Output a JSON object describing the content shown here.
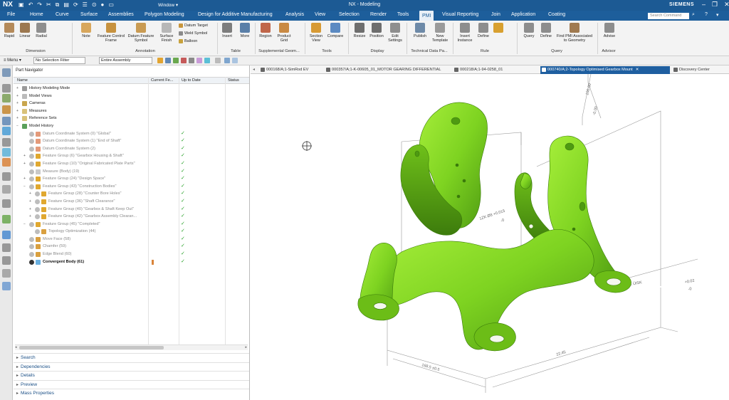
{
  "titlebar": {
    "logo": "NX",
    "window_menu": "Window ▾",
    "title": "NX - Modeling",
    "brand": "SIEMENS"
  },
  "menubar": {
    "items": [
      "File",
      "Home",
      "Curve",
      "Surface",
      "Assemblies",
      "Polygon Modeling",
      "Design for Additive Manufacturing",
      "Analysis",
      "View",
      "Selection",
      "Render",
      "Tools",
      "PMI",
      "Visual Reporting",
      "Join",
      "Application",
      "Coating"
    ],
    "active": "PMI",
    "search_placeholder": "Search Command"
  },
  "ribbon": {
    "dimension": {
      "buttons": [
        "Rapid",
        "Linear",
        "Radial"
      ],
      "label": "Dimension"
    },
    "annotation": {
      "buttons": [
        "Note",
        "Feature Control Frame",
        "Datum Feature Symbol",
        "Surface Finish"
      ],
      "small": [
        "Datum Target",
        "Weld Symbol",
        "Balloon"
      ],
      "label": "Annotation"
    },
    "table": {
      "buttons": [
        "Insert",
        "More"
      ],
      "label": "Table"
    },
    "supplemental": {
      "buttons": [
        "Region",
        "Product Grid"
      ],
      "label": "Supplemental Geom..."
    },
    "tools": {
      "buttons": [
        "Section View",
        "Compare"
      ],
      "label": "Tools"
    },
    "display": {
      "buttons": [
        "Resize",
        "Position",
        "Edit Settings"
      ],
      "label": "Display"
    },
    "technical_data": {
      "buttons": [
        "Publish",
        "New Template"
      ],
      "label": "Technical Data Pa..."
    },
    "rule": {
      "buttons": [
        "Insert Instance",
        "Define"
      ],
      "label": "Rule"
    },
    "query": {
      "buttons": [
        "Query",
        "Define",
        "Find PMI Associated to Geometry"
      ],
      "label": "Query"
    },
    "advisor": {
      "buttons": [
        "Advise"
      ],
      "label": "Advisor"
    }
  },
  "toolbar2": {
    "menu": "≡ Menu ▾",
    "selection_filter": "No Selection Filter",
    "assembly_scope": "Entire Assembly"
  },
  "part_navigator": {
    "title": "Part Navigator",
    "columns": [
      "Name",
      "Current Fe...",
      "Up to Date",
      "Status"
    ],
    "rows": [
      {
        "label": "History Modeling Mode",
        "level": 0,
        "style": "normal",
        "check": ""
      },
      {
        "label": "Model Views",
        "level": 0,
        "style": "normal",
        "check": ""
      },
      {
        "label": "Cameras",
        "level": 0,
        "style": "normal",
        "check": ""
      },
      {
        "label": "Measures",
        "level": 0,
        "style": "normal",
        "check": ""
      },
      {
        "label": "Reference Sets",
        "level": 0,
        "style": "normal",
        "check": ""
      },
      {
        "label": "Model History",
        "level": 0,
        "style": "normal",
        "check": ""
      },
      {
        "label": "Datum Coordinate System (0) \"Global\"",
        "level": 1,
        "style": "grey",
        "check": "✓"
      },
      {
        "label": "Datum Coordinate System (1) \"End of Shaft\"",
        "level": 1,
        "style": "grey",
        "check": "✓"
      },
      {
        "label": "Datum Coordinate System (2)",
        "level": 1,
        "style": "grey",
        "check": "✓"
      },
      {
        "label": "Feature Group (6) \"Gearbox Housing & Shaft\"",
        "level": 1,
        "style": "grey",
        "check": "✓"
      },
      {
        "label": "Feature Group (10) \"Original Fabricated Plate Parts\"",
        "level": 1,
        "style": "grey",
        "check": "✓"
      },
      {
        "label": "Measure (Body) (19)",
        "level": 1,
        "style": "grey",
        "check": "✓"
      },
      {
        "label": "Feature Group (24) \"Design Space\"",
        "level": 1,
        "style": "grey",
        "check": "✓"
      },
      {
        "label": "Feature Group (43) \"Construction Bodies\"",
        "level": 1,
        "style": "grey",
        "check": "✓"
      },
      {
        "label": "Feature Group (28) \"Counter Bore Holes\"",
        "level": 2,
        "style": "grey",
        "check": "✓"
      },
      {
        "label": "Feature Group (36) \"Shaft Clearance\"",
        "level": 2,
        "style": "grey",
        "check": "✓"
      },
      {
        "label": "Feature Group (40) \"Gearbox & Shaft Keep Out\"",
        "level": 2,
        "style": "grey",
        "check": "✓"
      },
      {
        "label": "Feature Group (42) \"Gearbox Assembly Clearan...",
        "level": 2,
        "style": "grey",
        "check": "✓"
      },
      {
        "label": "Feature Group (45) \"Completed\"",
        "level": 1,
        "style": "grey",
        "check": "✓"
      },
      {
        "label": "Topology Optimization (44)",
        "level": 2,
        "style": "grey",
        "check": "✓"
      },
      {
        "label": "Move Face (58)",
        "level": 1,
        "style": "grey",
        "check": "✓"
      },
      {
        "label": "Chamfer (59)",
        "level": 1,
        "style": "grey",
        "check": "✓"
      },
      {
        "label": "Edge Blend (60)",
        "level": 1,
        "style": "grey",
        "check": "✓"
      },
      {
        "label": "Convergent Body (61)",
        "level": 1,
        "style": "bold",
        "check": "✓"
      }
    ],
    "panels": [
      "Search",
      "Dependencies",
      "Details",
      "Preview",
      "Mass Properties"
    ]
  },
  "tabs": [
    {
      "label": "000168/A;1-SimRod EV",
      "active": false
    },
    {
      "label": "000357/A;1-K-00605_01_MOTOR GEARING DIFFERENTIAL",
      "active": false
    },
    {
      "label": "000218/A;1-94-0258_01",
      "active": false
    },
    {
      "label": "000740/A;2-Topology Optimised Gearbox Mount",
      "active": true
    },
    {
      "label": "Discovery Center",
      "active": false
    }
  ],
  "viewport": {
    "model_color": "#7ed321",
    "dims": [
      "100.00",
      "-0.00",
      "1ZK  Ø8  +0.015",
      "-0",
      "OK  ÜISK",
      "+0.02",
      "-0",
      "168.5  ±0.5",
      "22.45"
    ]
  },
  "colors": {
    "titlebar": "#1c5a94",
    "menubar": "#1d5e9b",
    "accent": "#1f5fa0",
    "check": "#2aa12a",
    "model": "#7ed321"
  }
}
